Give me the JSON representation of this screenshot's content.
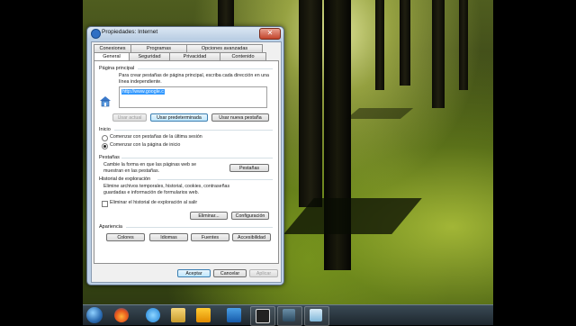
{
  "window": {
    "title": "Propiedades: Internet",
    "close_label": "✕"
  },
  "tabs_top": [
    "Conexiones",
    "Programas",
    "Opciones avanzadas"
  ],
  "tabs_bottom": [
    "General",
    "Seguridad",
    "Privacidad",
    "Contenido"
  ],
  "home": {
    "section_label": "Página principal",
    "description": "Para crear pestañas de página principal, escriba cada dirección en una línea independiente.",
    "url": "http://www.google.c",
    "btn_current": "Usar actual",
    "btn_default": "Usar predeterminada",
    "btn_new_tab": "Usar nueva pestaña"
  },
  "startup": {
    "section_label": "Inicio",
    "option_tabs": "Comenzar con pestañas de la última sesión",
    "option_home": "Comenzar con la página de inicio"
  },
  "tabs_section": {
    "section_label": "Pestañas",
    "description": "Cambie la forma en que las páginas web se muestran en las pestañas.",
    "button": "Pestañas"
  },
  "history": {
    "section_label": "Historial de exploración",
    "description": "Elimine archivos temporales, historial, cookies, contraseñas guardadas e información de formularios web.",
    "checkbox": "Eliminar el historial de exploración al salir",
    "btn_delete": "Eliminar...",
    "btn_settings": "Configuración"
  },
  "appearance": {
    "section_label": "Apariencia",
    "btn_colors": "Colores",
    "btn_languages": "Idiomas",
    "btn_fonts": "Fuentes",
    "btn_accessibility": "Accesibilidad"
  },
  "footer": {
    "ok": "Aceptar",
    "cancel": "Cancelar",
    "apply": "Aplicar"
  },
  "taskbar": {
    "icons": [
      "windows-start",
      "firefox",
      "internet-explorer",
      "file-explorer",
      "media-player",
      "outlook",
      "film-app",
      "image-app",
      "control-panel-app"
    ]
  }
}
